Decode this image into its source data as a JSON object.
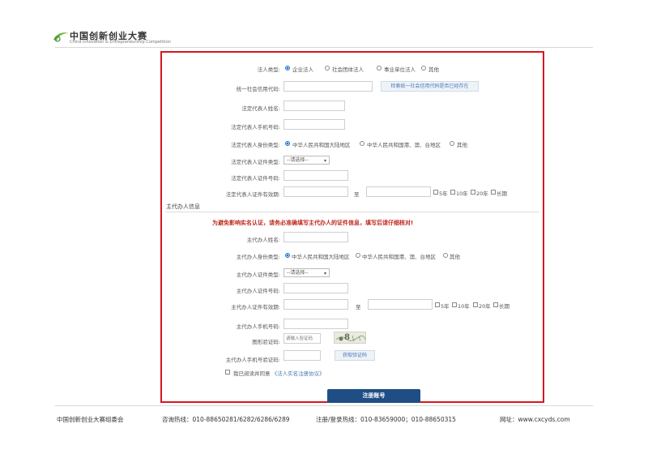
{
  "header": {
    "logo_title": "中国创新创业大赛",
    "logo_subtitle": "China Innovation & Entrepreneurship Competition"
  },
  "form": {
    "legal_type": {
      "label": "法人类型:",
      "options": [
        "企业法人",
        "社会团体法人",
        "事业单位法人",
        "其他"
      ],
      "selected": 0
    },
    "credit_code": {
      "label": "统一社会信用代码:",
      "value": "",
      "check_button": "检索统一社会信用代码是否已经存在"
    },
    "rep_name": {
      "label": "法定代表人姓名:",
      "value": ""
    },
    "rep_phone": {
      "label": "法定代表人手机号码:",
      "value": ""
    },
    "rep_identity": {
      "label": "法定代表人身份类型:",
      "options": [
        "中华人民共和国大陆地区",
        "中华人民共和国港、澳、台地区",
        "其他"
      ],
      "selected": 0
    },
    "rep_cert_type": {
      "label": "法定代表人证件类型:",
      "selected": "--请选择--"
    },
    "rep_cert_no": {
      "label": "法定代表人证件号码:",
      "value": ""
    },
    "rep_cert_valid": {
      "label": "法定代表人证件有效期:",
      "to": "至",
      "options": [
        "5年",
        "10年",
        "20年",
        "长期"
      ]
    }
  },
  "agent": {
    "section_title": "主代办人信息",
    "warning": "为避免影响实名认证，请务必准确填写主代办人的证件信息，填写后请仔细核对!",
    "name": {
      "label": "主代办人姓名:",
      "value": ""
    },
    "identity": {
      "label": "主代办人身份类型:",
      "options": [
        "中华人民共和国大陆地区",
        "中华人民共和国港、澳、台地区",
        "其他"
      ],
      "selected": 0
    },
    "cert_type": {
      "label": "主代办人证件类型:",
      "selected": "--请选择--"
    },
    "cert_no": {
      "label": "主代办人证件号码:",
      "value": ""
    },
    "cert_valid": {
      "label": "主代办人证件有效期:",
      "to": "至",
      "options": [
        "5年",
        "10年",
        "20年",
        "长期"
      ]
    },
    "phone": {
      "label": "主代办人手机号码:",
      "value": ""
    },
    "captcha": {
      "label": "图形验证码:",
      "placeholder": "请输入验证码",
      "image_text": "8"
    },
    "sms": {
      "label": "主代办人手机号验证码:",
      "button": "获取验证码"
    },
    "agreement": {
      "prefix": "我已阅读并同意",
      "link": "《法人实名注册协议》",
      "checked": false
    }
  },
  "submit": {
    "label": "注册账号"
  },
  "footer": {
    "org": "中国创新创业大赛组委会",
    "consult": "咨询热线：010-88650281/6282/6286/6289",
    "reg": "注册/登录热线：010-83659000；010-88650315",
    "site": "网址：www.cxcyds.com"
  },
  "colors": {
    "frame": "#d6181f",
    "primary": "#1f4e85",
    "accent": "#1a6fd8",
    "warning": "#c0281f"
  }
}
